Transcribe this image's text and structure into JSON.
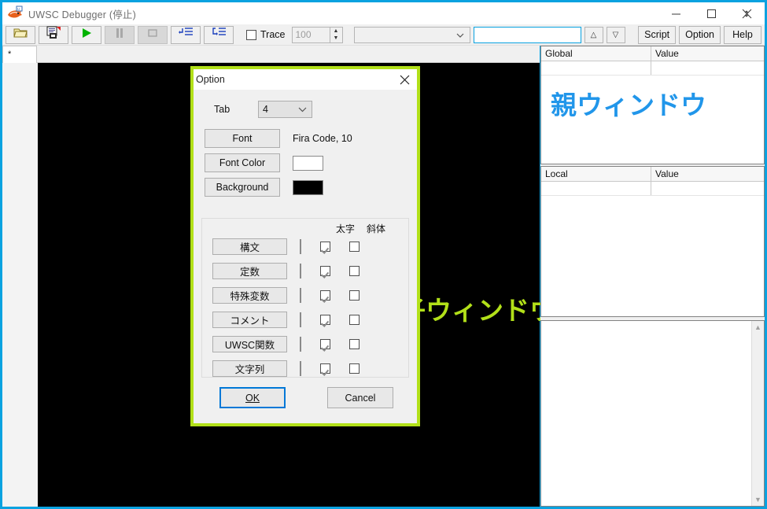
{
  "window": {
    "title": "UWSC Debugger (停止)",
    "icon": "uwsc-app-icon",
    "minimize_label": "—",
    "maximize_label": "☐",
    "close_label": "✕"
  },
  "toolbar": {
    "buttons": [
      {
        "name": "open-file-button",
        "icon": "folder-open-icon",
        "enabled": true
      },
      {
        "name": "save-file-button",
        "icon": "save-disk-icon",
        "enabled": true
      },
      {
        "name": "run-button",
        "icon": "play-icon",
        "enabled": true
      },
      {
        "name": "pause-button",
        "icon": "pause-icon",
        "enabled": false
      },
      {
        "name": "stop-button",
        "icon": "stop-icon",
        "enabled": false
      },
      {
        "name": "step-into-button",
        "icon": "step-into-icon",
        "enabled": true
      },
      {
        "name": "step-over-button",
        "icon": "step-over-icon",
        "enabled": true
      }
    ],
    "trace_label": "Trace",
    "trace_checked": false,
    "trace_value": "100",
    "combo_value": "",
    "search_value": "",
    "up_label": "△",
    "down_label": "▽",
    "script_label": "Script",
    "option_label": "Option",
    "help_label": "Help"
  },
  "editor": {
    "tab_label": "*",
    "child_window_label": "子ウィンドウ",
    "child_window_color": "#b2e019",
    "background_color": "#000000",
    "gutter_color": "#f3f3f3"
  },
  "panels": {
    "global": {
      "col1": "Global",
      "col2": "Value",
      "rows": [
        {
          "name": "",
          "value": ""
        }
      ]
    },
    "local": {
      "col1": "Local",
      "col2": "Value",
      "rows": [
        {
          "name": "",
          "value": ""
        }
      ]
    },
    "parent_window_label": "親ウィンドウ",
    "parent_window_color": "#2196ea",
    "output_text": ""
  },
  "option_dialog": {
    "title": "Option",
    "close_label": "✕",
    "border_color": "#b2e019",
    "tab_label": "Tab",
    "tab_value": "4",
    "tab_chevron": "∨",
    "font_button": "Font",
    "font_value": "Fira Code, 10",
    "font_color_button": "Font Color",
    "font_color_value": "#ffffff",
    "background_button": "Background",
    "background_value": "#000000",
    "col_bold": "太字",
    "col_italic": "斜体",
    "rows": [
      {
        "label": "構文",
        "color": "#ffffff",
        "bold": true,
        "italic": false
      },
      {
        "label": "定数",
        "color": "#ff80ff",
        "bold": true,
        "italic": false
      },
      {
        "label": "特殊変数",
        "color": "#8080ff",
        "bold": true,
        "italic": false
      },
      {
        "label": "コメント",
        "color": "#808080",
        "bold": true,
        "italic": false
      },
      {
        "label": "UWSC関数",
        "color": "#ff8000",
        "bold": true,
        "italic": false
      },
      {
        "label": "文字列",
        "color": "#c0c0c0",
        "bold": true,
        "italic": false
      }
    ],
    "ok_label": "OK",
    "ok_accesskey": "O",
    "cancel_label": "Cancel"
  }
}
